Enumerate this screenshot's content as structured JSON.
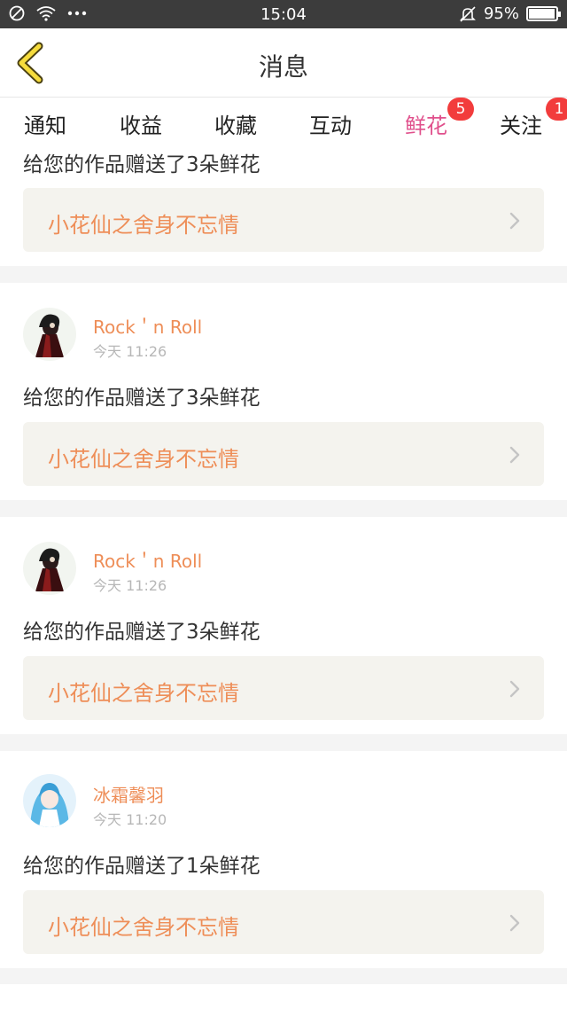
{
  "status_bar": {
    "time": "15:04",
    "battery": "95%",
    "battery_level": 0.95,
    "icons": [
      "blocked-icon",
      "wifi-icon",
      "more-dots-icon",
      "bell-off-icon",
      "battery-icon"
    ]
  },
  "header": {
    "title": "消息"
  },
  "tabs": [
    {
      "label": "通知",
      "badge": ""
    },
    {
      "label": "收益",
      "badge": ""
    },
    {
      "label": "收藏",
      "badge": ""
    },
    {
      "label": "互动",
      "badge": ""
    },
    {
      "label": "鲜花",
      "badge": "5"
    },
    {
      "label": "关注",
      "badge": "1"
    }
  ],
  "colors": {
    "accent": "#e0508c",
    "username": "#ee8e58",
    "badge": "#f23c3c"
  },
  "cards": [
    {
      "message": "给您的作品赠送了3朵鲜花",
      "work_title": "小花仙之舍身不忘情"
    },
    {
      "username": "Rock＇n Roll",
      "time": "今天 11:26",
      "message": "给您的作品赠送了3朵鲜花",
      "work_title": "小花仙之舍身不忘情"
    },
    {
      "username": "Rock＇n Roll",
      "time": "今天 11:26",
      "message": "给您的作品赠送了3朵鲜花",
      "work_title": "小花仙之舍身不忘情"
    },
    {
      "username": "冰霜馨羽",
      "time": "今天 11:20",
      "message": "给您的作品赠送了1朵鲜花",
      "work_title": "小花仙之舍身不忘情"
    }
  ]
}
